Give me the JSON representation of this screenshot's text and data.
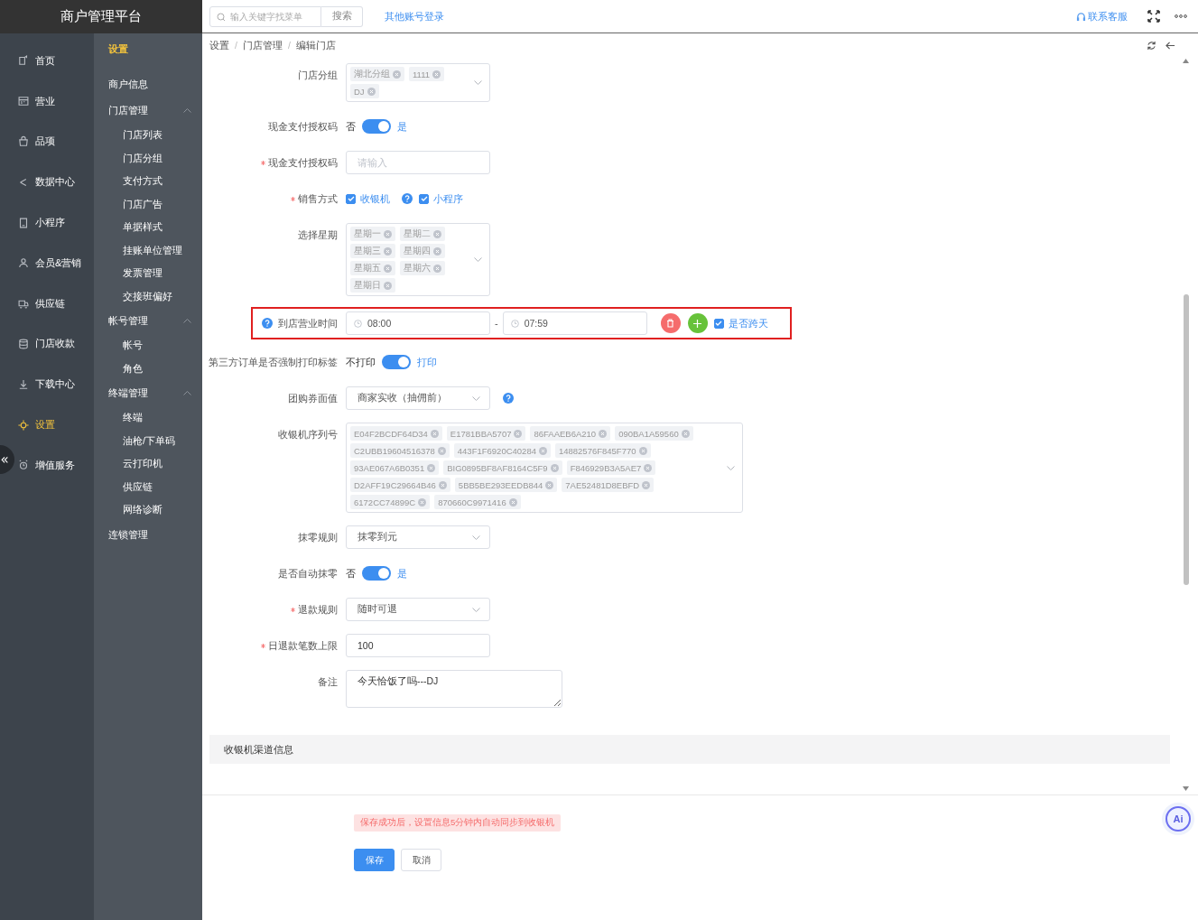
{
  "logo": "商户管理平台",
  "top_bar": {
    "search": {
      "placeholder": "输入关键字找菜单",
      "button": "搜索"
    },
    "link": "其他账号登录",
    "service": "联系客服"
  },
  "main_menu": [
    {
      "label": "首页",
      "selected": false
    },
    {
      "label": "营业",
      "selected": false
    },
    {
      "label": "品项",
      "selected": false
    },
    {
      "label": "数据中心",
      "selected": false
    },
    {
      "label": "小程序",
      "selected": false
    },
    {
      "label": "会员&营销",
      "selected": false
    },
    {
      "label": "供应链",
      "selected": false
    },
    {
      "label": "门店收款",
      "selected": false
    },
    {
      "label": "下载中心",
      "selected": false
    },
    {
      "label": "设置",
      "selected": true
    },
    {
      "label": "增值服务",
      "selected": false
    }
  ],
  "collapse_button": "«",
  "submenu": {
    "title": "设置",
    "items": [
      {
        "label": "商户信息"
      },
      {
        "label": "门店管理",
        "expanded": true,
        "children": [
          "门店列表",
          "门店分组",
          "支付方式",
          "门店广告",
          "单据样式",
          "挂账单位管理",
          "发票管理",
          "交接班偏好"
        ]
      },
      {
        "label": "帐号管理",
        "expanded": true,
        "children": [
          "帐号",
          "角色"
        ]
      },
      {
        "label": "终端管理",
        "expanded": true,
        "children": [
          "终端",
          "油枪/下单码",
          "云打印机",
          "供应链",
          "网络诊断"
        ]
      },
      {
        "label": "连锁管理"
      }
    ]
  },
  "breadcrumb": {
    "items": [
      "设置",
      "门店管理",
      "编辑门店"
    ],
    "separator": "/"
  },
  "form": [
    {
      "kind": "tags",
      "label": "门店分组",
      "required": false,
      "tags": [
        "湖北分组",
        "1111",
        "DJ"
      ],
      "narrow": true
    },
    {
      "kind": "switch",
      "label": "现金支付授权码",
      "required": false,
      "off_text": "否",
      "on_text": "是",
      "on": true
    },
    {
      "kind": "input",
      "label": "现金支付授权码",
      "required": true,
      "placeholder": "请输入"
    },
    {
      "kind": "checks",
      "label": "销售方式",
      "required": true,
      "options": [
        {
          "label": "收银机",
          "checked": true,
          "help": true
        },
        {
          "label": "小程序",
          "checked": true,
          "help": false
        }
      ]
    },
    {
      "kind": "tags",
      "label": "选择星期",
      "required": false,
      "tags": [
        "星期一",
        "星期二",
        "星期三",
        "星期四",
        "星期五",
        "星期六",
        "星期日"
      ],
      "narrow": true
    },
    {
      "kind": "time",
      "label": "到店营业时间",
      "required": false,
      "highlighted": true,
      "start": "08:00",
      "separator": "-",
      "end": "07:59",
      "cross_day": {
        "label": "是否跨天",
        "checked": true
      }
    },
    {
      "kind": "switch",
      "label": "第三方订单是否强制打印标签",
      "required": false,
      "off_text": "不打印",
      "on_text": "打印",
      "on": true
    },
    {
      "kind": "select",
      "label": "团购券面值",
      "required": false,
      "value": "商家实收（抽佣前）",
      "help": true
    },
    {
      "kind": "tags",
      "label": "收银机序列号",
      "required": false,
      "tags": [
        "E04F2BCDF64D34",
        "E1781BBA5707",
        "86FAAEB6A210",
        "090BA1A59560",
        "C2UBB19604516378",
        "443F1F6920C40284",
        "14882576F845F770",
        "93AE067A6B0351",
        "BIG0895BF8AF8164C5F9",
        "F846929B3A5AE7",
        "D2AFF19C29664B46",
        "5BB5BE293EEDB844",
        "7AE52481D8EBFD",
        "6172CC74899C",
        "870660C9971416"
      ],
      "narrow": false
    },
    {
      "kind": "select",
      "label": "抹零规则",
      "required": false,
      "value": "抹零到元",
      "help": false
    },
    {
      "kind": "switch",
      "label": "是否自动抹零",
      "required": false,
      "off_text": "否",
      "on_text": "是",
      "on": true
    },
    {
      "kind": "select",
      "label": "退款规则",
      "required": true,
      "value": "随时可退",
      "help": false
    },
    {
      "kind": "input",
      "label": "日退款笔数上限",
      "required": true,
      "value": "100"
    },
    {
      "kind": "textarea",
      "label": "备注",
      "required": false,
      "value": "今天恰饭了吗---DJ"
    }
  ],
  "section_title": "收银机渠道信息",
  "notice": "保存成功后，设置信息5分钟内自动同步到收银机",
  "buttons": [
    {
      "label": "保存",
      "primary": true
    },
    {
      "label": "取消",
      "primary": false
    }
  ],
  "ai_button": "Ai"
}
